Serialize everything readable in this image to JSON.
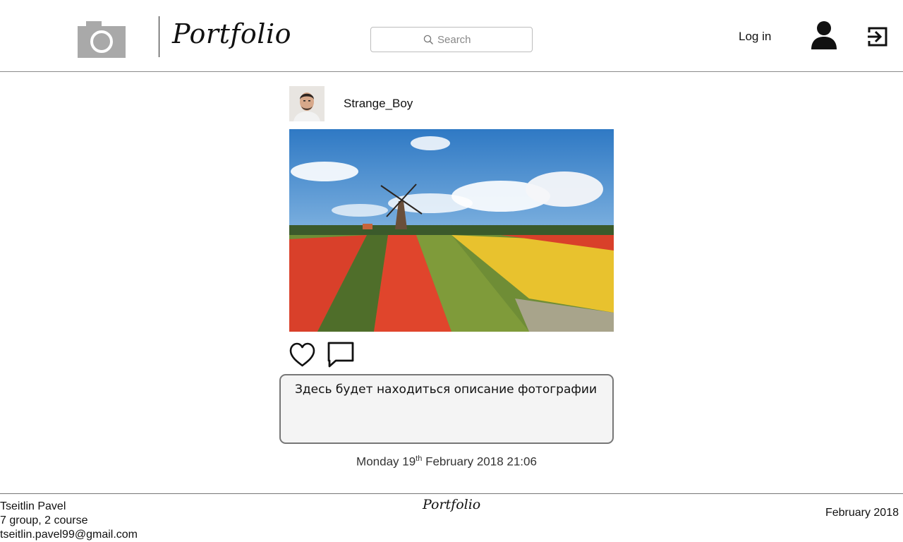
{
  "header": {
    "brand_title": "Portfolio",
    "search_placeholder": "Search",
    "login_label": "Log in"
  },
  "post": {
    "author_name": "Strange_Boy",
    "description": "Здесь будет находиться описание фотографии",
    "date": {
      "weekday_day": "Monday 19",
      "ordinal_suffix": "th",
      "rest": "February 2018 21:06"
    }
  },
  "footer": {
    "author": "Tseitlin Pavel",
    "group": "7 group, 2 course",
    "email": "tseitlin.pavel99@gmail.com",
    "brand": "Portfolio",
    "date": "February 2018"
  },
  "icons": {
    "logo": "camera-icon",
    "search": "search-icon",
    "user": "user-icon",
    "logout": "logout-icon",
    "like": "heart-icon",
    "comment": "comment-icon"
  },
  "colors": {
    "camera_gray": "#a9a9a9",
    "description_bg": "#f4f4f4",
    "description_border": "#777777"
  }
}
